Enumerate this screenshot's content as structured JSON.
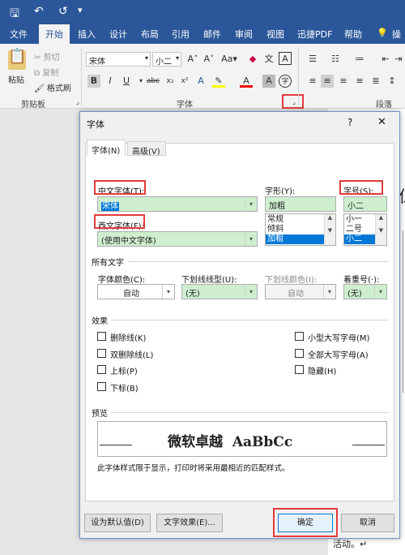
{
  "titlebar": {
    "save_icon": "save-icon",
    "undo_icon": "undo-icon",
    "redo_icon": "redo-icon"
  },
  "ribbon_tabs": [
    "文件",
    "开始",
    "插入",
    "设计",
    "布局",
    "引用",
    "邮件",
    "审阅",
    "视图",
    "迅捷PDF",
    "帮助",
    "操"
  ],
  "clipboard": {
    "paste": "粘贴",
    "cut": "剪切",
    "copy": "复制",
    "format_painter": "格式刷",
    "group": "剪贴板"
  },
  "font_group": {
    "font_name": "宋体",
    "font_size": "小二",
    "group": "字体"
  },
  "para_group": {
    "group": "段落"
  },
  "dialog": {
    "title": "字体",
    "help": "?",
    "close": "✕",
    "tabs": [
      "字体(N)",
      "高级(V)"
    ],
    "chinese_font_label": "中文字体(T):",
    "chinese_font_value": "宋体",
    "western_font_label": "西文字体(F):",
    "western_font_value": "(使用中文字体)",
    "style_label": "字形(Y):",
    "style_value": "加粗",
    "style_options": [
      "常规",
      "倾斜",
      "加粗"
    ],
    "size_label": "字号(S):",
    "size_value": "小二",
    "size_options": [
      "小一",
      "二号",
      "小二"
    ],
    "all_text_label": "所有文字",
    "color_label": "字体颜色(C):",
    "color_value": "自动",
    "underline_label": "下划线线型(U):",
    "underline_value": "(无)",
    "underline_color_label": "下划线颜色(I):",
    "underline_color_value": "自动",
    "emphasis_label": "着重号(·):",
    "emphasis_value": "(无)",
    "effects_label": "效果",
    "effects_left": [
      "删除线(K)",
      "双删除线(L)",
      "上标(P)",
      "下标(B)"
    ],
    "effects_right": [
      "小型大写字母(M)",
      "全部大写字母(A)",
      "隐藏(H)"
    ],
    "preview_label": "预览",
    "preview_text": "微软卓越  AaBbCc",
    "note": "此字体样式限于显示，打印时将采用最相近的匹配样式。",
    "default_btn": "设为默认值(D)",
    "text_effects_btn": "文字效果(E)...",
    "ok_btn": "确定",
    "cancel_btn": "取消"
  },
  "doc_right": {
    "footer_text": "活动。↵"
  },
  "colors": {
    "word_blue": "#2b579a",
    "highlight_red": "#e23b3b",
    "field_green": "#cfeecf"
  }
}
